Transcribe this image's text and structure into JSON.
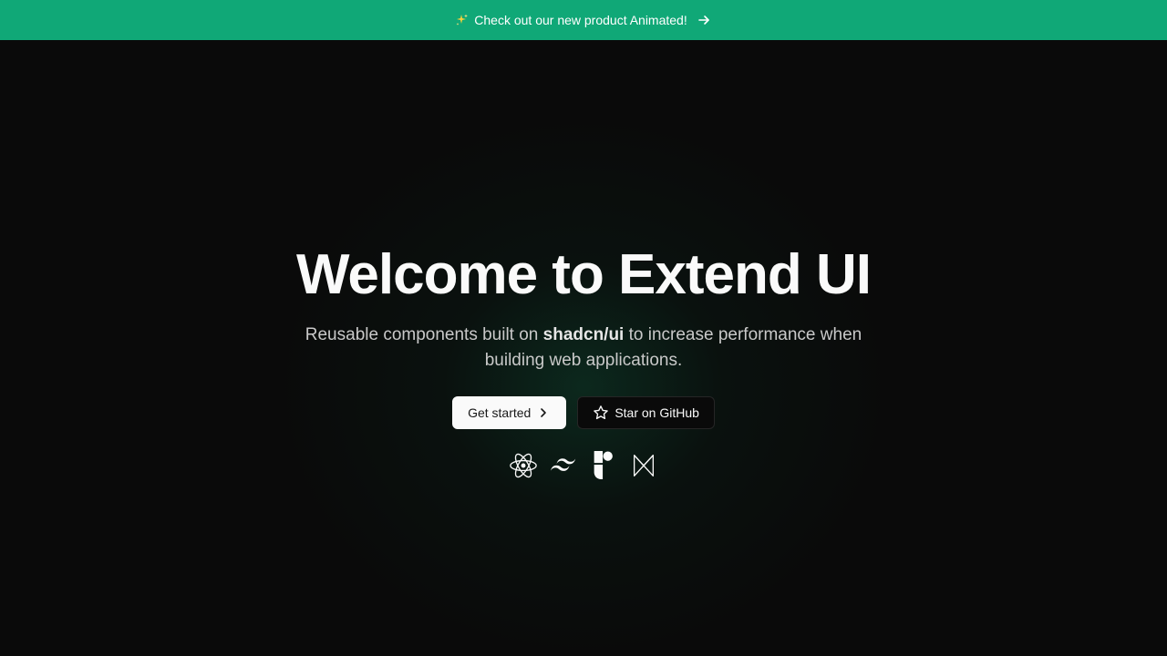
{
  "banner": {
    "text": "Check out our new product Animated!",
    "icon": "sparkle-icon",
    "arrow_icon": "arrow-right-icon",
    "background": "#10a877"
  },
  "hero": {
    "title": "Welcome to Extend UI",
    "subtitle_before": "Reusable components built on ",
    "subtitle_bold": "shadcn/ui",
    "subtitle_after": " to increase performance when building web applications."
  },
  "actions": {
    "primary_label": "Get started",
    "primary_icon": "chevron-right-icon",
    "secondary_label": "Star on GitHub",
    "secondary_icon": "star-icon"
  },
  "tech_stack": [
    "react-icon",
    "tailwind-icon",
    "framer-icon",
    "motion-icon"
  ],
  "colors": {
    "background": "#0a0a0a",
    "accent": "#10a877",
    "text": "#fafafa",
    "muted": "#c9c9c9"
  }
}
